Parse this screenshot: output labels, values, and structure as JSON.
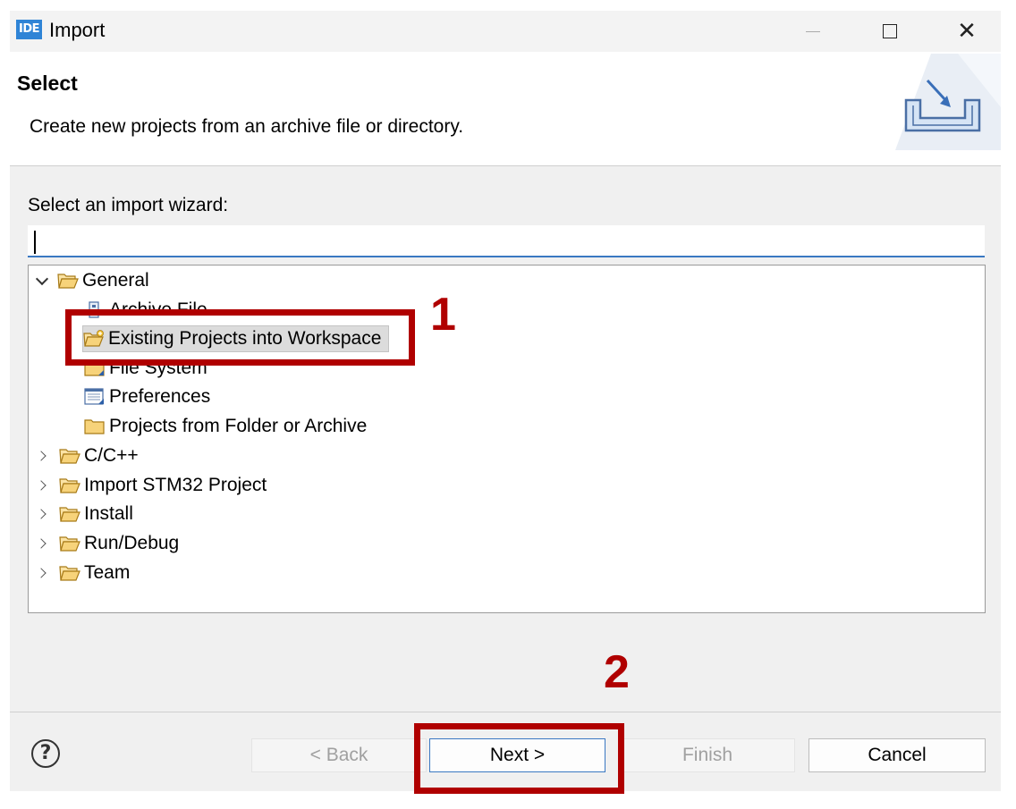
{
  "window": {
    "app_logo": "IDE",
    "title": "Import"
  },
  "header": {
    "title": "Select",
    "description": "Create new projects from an archive file or directory."
  },
  "wizard": {
    "label": "Select an import wizard:",
    "filter_value": ""
  },
  "tree": {
    "general": {
      "label": "General",
      "children": [
        "Archive File",
        "Existing Projects into Workspace",
        "File System",
        "Preferences",
        "Projects from Folder or Archive"
      ]
    },
    "categories": [
      "C/C++",
      "Import STM32 Project",
      "Install",
      "Run/Debug",
      "Team"
    ],
    "selected": "Existing Projects into Workspace"
  },
  "annotations": {
    "step1": "1",
    "step2": "2",
    "color": "#b00000"
  },
  "buttons": {
    "help": "?",
    "back": "< Back",
    "next": "Next >",
    "finish": "Finish",
    "cancel": "Cancel"
  }
}
